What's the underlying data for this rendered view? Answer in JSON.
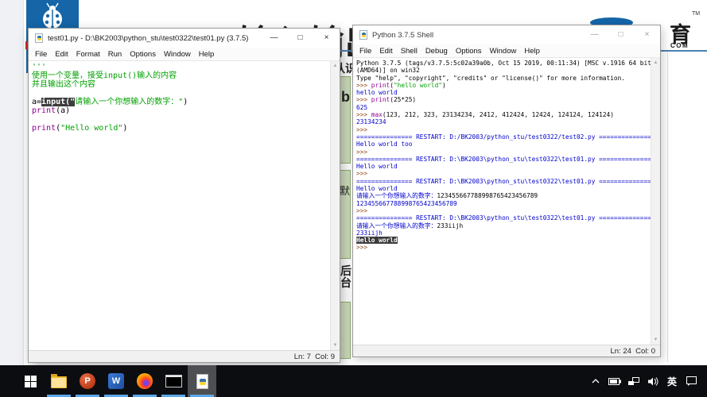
{
  "desktop": {
    "page_title": "Python 输入输出",
    "accent_blue": "#1565a7",
    "brand": {
      "glyph": "育",
      "tm": "TM",
      "com": "COM"
    },
    "slide": {
      "fragment_top": "认识",
      "fragment_b": "b",
      "fragment_mo": "默",
      "fragment_bottom": "后台"
    }
  },
  "palette": {
    "txt": "#000000",
    "out": "#0000cd",
    "str": "#00a000",
    "blt": "#900090",
    "prm": "#8b4513",
    "sel_bg": "#3c3c3c",
    "sel_fg": "#ffffff"
  },
  "window_controls": {
    "minimize": "—",
    "maximize": "□",
    "close": "×"
  },
  "editor": {
    "title": "test01.py - D:\\BK2003\\python_stu\\test0322\\test01.py (3.7.5)",
    "menus": [
      "File",
      "Edit",
      "Format",
      "Run",
      "Options",
      "Window",
      "Help"
    ],
    "status": "Ln: 7  Col: 9",
    "lines": [
      [
        [
          "'''",
          "str"
        ]
      ],
      [
        [
          "使用一个变量，接受input()输入的内容",
          "str"
        ]
      ],
      [
        [
          "并且输出这个内容",
          "str"
        ]
      ],
      [],
      [
        [
          "a=",
          "txt"
        ],
        [
          "input(\"",
          "sel"
        ],
        [
          "请输入一个你想输入的数字：\"",
          "str"
        ],
        [
          ")",
          "txt"
        ]
      ],
      [
        [
          "print",
          "blt"
        ],
        [
          "(a)",
          "txt"
        ]
      ],
      [],
      [
        [
          "print",
          "blt"
        ],
        [
          "(",
          "txt"
        ],
        [
          "\"Hello world\"",
          "str"
        ],
        [
          ")",
          "txt"
        ]
      ]
    ]
  },
  "shell": {
    "title": "Python 3.7.5 Shell",
    "menus": [
      "File",
      "Edit",
      "Shell",
      "Debug",
      "Options",
      "Window",
      "Help"
    ],
    "status": "Ln: 24  Col: 0",
    "lines": [
      [
        [
          "Python 3.7.5 (tags/v3.7.5:5c02a39a0b, Oct 15 2019, 00:11:34) [MSC v.1916 64 bit",
          "txt"
        ]
      ],
      [
        [
          "(AMD64)] on win32",
          "txt"
        ]
      ],
      [
        [
          "Type \"help\", \"copyright\", \"credits\" or \"license()\" for more information.",
          "txt"
        ]
      ],
      [
        [
          ">>> ",
          "prm"
        ],
        [
          "print",
          "blt"
        ],
        [
          "(",
          "txt"
        ],
        [
          "\"hello world\"",
          "str"
        ],
        [
          ")",
          "txt"
        ]
      ],
      [
        [
          "hello world",
          "out"
        ]
      ],
      [
        [
          ">>> ",
          "prm"
        ],
        [
          "print",
          "blt"
        ],
        [
          "(25*25)",
          "txt"
        ]
      ],
      [
        [
          "625",
          "out"
        ]
      ],
      [
        [
          ">>> ",
          "prm"
        ],
        [
          "max",
          "blt"
        ],
        [
          "(123, 212, 323, 23134234, 2412, 412424, 12424, 124124, 124124)",
          "txt"
        ]
      ],
      [
        [
          "23134234",
          "out"
        ]
      ],
      [
        [
          ">>>",
          "prm"
        ]
      ],
      [
        [
          "=============== RESTART: D:/BK2003/python_stu/test0322/test02.py ===============",
          "out"
        ]
      ],
      [
        [
          "Hello world too",
          "out"
        ]
      ],
      [
        [
          ">>>",
          "prm"
        ]
      ],
      [
        [
          "=============== RESTART: D:\\BK2003\\python_stu\\test0322\\test01.py ===============",
          "out"
        ]
      ],
      [
        [
          "Hello world",
          "out"
        ]
      ],
      [
        [
          ">>>",
          "prm"
        ]
      ],
      [
        [
          "=============== RESTART: D:\\BK2003\\python_stu\\test0322\\test01.py ===============",
          "out"
        ]
      ],
      [
        [
          "Hello world",
          "out"
        ]
      ],
      [
        [
          "请输入一个你想输入的数字：",
          "out"
        ],
        [
          "123455667788998765423456789",
          "txt"
        ]
      ],
      [
        [
          "123455667788998765423456789",
          "out"
        ]
      ],
      [
        [
          ">>>",
          "prm"
        ]
      ],
      [
        [
          "=============== RESTART: D:\\BK2003\\python_stu\\test0322\\test01.py ===============",
          "out"
        ]
      ],
      [
        [
          "请输入一个你想输入的数字：",
          "out"
        ],
        [
          "233iijh",
          "txt"
        ]
      ],
      [
        [
          "233iijh",
          "out"
        ]
      ],
      [
        [
          "Hello world",
          "sel"
        ]
      ],
      [
        [
          ">>>",
          "prm"
        ]
      ]
    ]
  },
  "taskbar": {
    "icons": [
      "start",
      "file-explorer",
      "powerpoint",
      "word",
      "firefox",
      "terminal",
      "python-idle"
    ],
    "active_icon": "python-idle",
    "icon_letters": {
      "powerpoint": "P",
      "word": "W"
    },
    "underline_color": "#5ba7e8",
    "tray": [
      "hidden-icons-chevron",
      "battery",
      "network",
      "volume",
      "ime",
      "action-center"
    ],
    "ime_label": "英"
  }
}
